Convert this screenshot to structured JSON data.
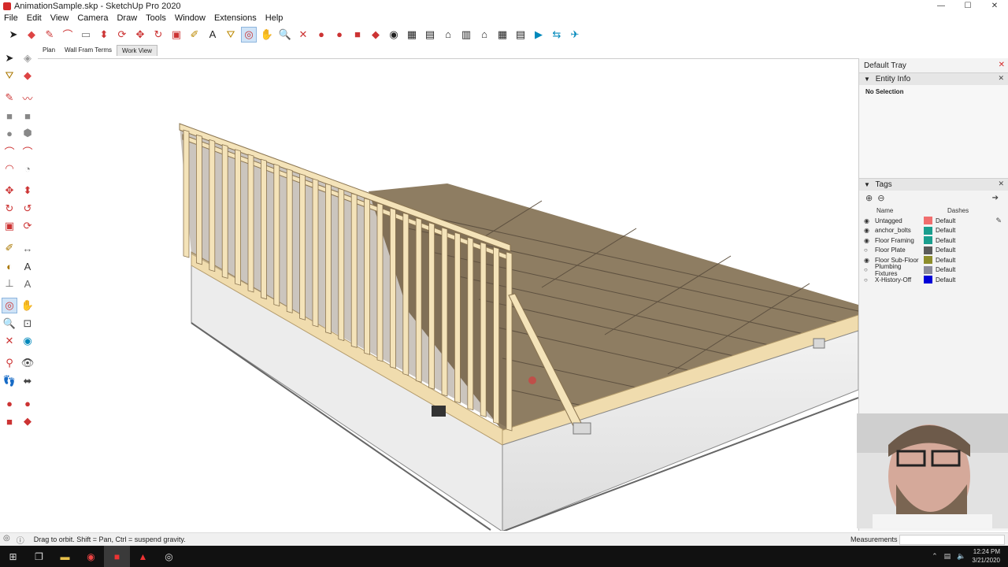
{
  "window": {
    "title": "AnimationSample.skp - SketchUp Pro 2020",
    "controls": [
      "—",
      "☐",
      "✕"
    ]
  },
  "menu": [
    "File",
    "Edit",
    "View",
    "Camera",
    "Draw",
    "Tools",
    "Window",
    "Extensions",
    "Help"
  ],
  "scene_tabs": [
    "Plan",
    "Wall Fram Terms",
    "Work View"
  ],
  "active_scene_tab": "Work View",
  "tray": {
    "title": "Default Tray",
    "entity_info": {
      "title": "Entity Info",
      "selection": "No Selection"
    },
    "tags": {
      "title": "Tags",
      "columns": {
        "name": "Name",
        "dashes": "Dashes"
      },
      "rows": [
        {
          "name": "Untagged",
          "color": "#f06e6e",
          "dashes": "Default",
          "visible": true
        },
        {
          "name": "anchor_bolts",
          "color": "#1a9e8e",
          "dashes": "Default",
          "visible": true
        },
        {
          "name": "Floor Framing",
          "color": "#1a9e8e",
          "dashes": "Default",
          "visible": true
        },
        {
          "name": "Floor Plate",
          "color": "#5b5b5b",
          "dashes": "Default",
          "visible": false
        },
        {
          "name": "Floor Sub-Floor",
          "color": "#8d8d2c",
          "dashes": "Default",
          "visible": true
        },
        {
          "name": "Plumbing Fixtures",
          "color": "#8a8a9a",
          "dashes": "Default",
          "visible": false
        },
        {
          "name": "X-History-Off",
          "color": "#0000d8",
          "dashes": "Default",
          "visible": false
        }
      ]
    }
  },
  "status": {
    "message": "Drag to orbit. Shift = Pan, Ctrl = suspend gravity.",
    "measurements_label": "Measurements"
  },
  "taskbar": {
    "time": "12:24 PM",
    "date": "3/21/2020"
  },
  "colors": {
    "accent": "#d42a2a",
    "wood": "#efd9a8",
    "floor": "#8c7a60"
  }
}
